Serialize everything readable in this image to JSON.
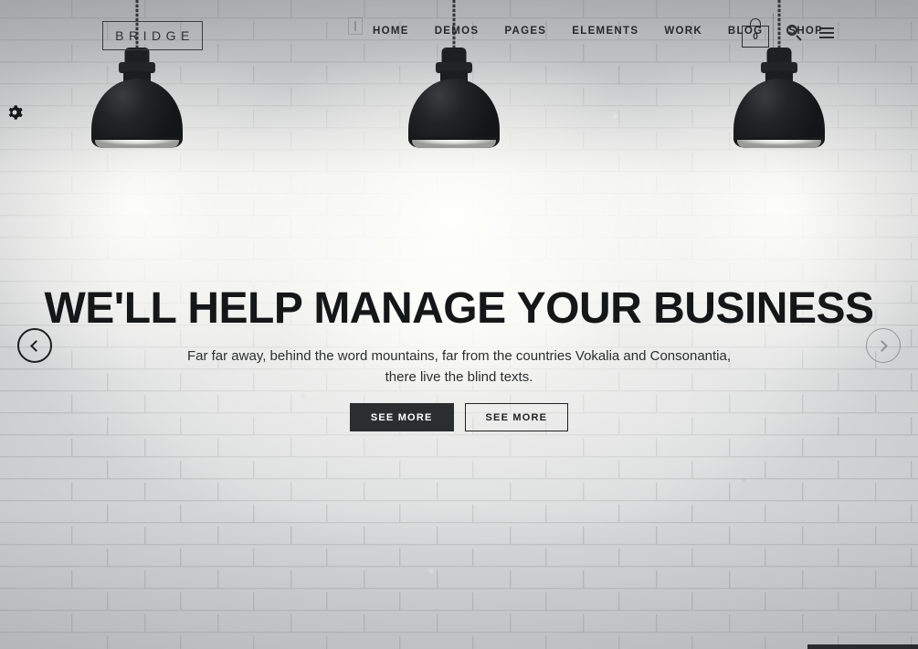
{
  "site": {
    "logo_text": "BRIDGE"
  },
  "header": {
    "nav_items": [
      {
        "label": "HOME"
      },
      {
        "label": "DEMOS"
      },
      {
        "label": "PAGES"
      },
      {
        "label": "ELEMENTS"
      },
      {
        "label": "WORK"
      },
      {
        "label": "BLOG"
      },
      {
        "label": "SHOP"
      }
    ],
    "cart_count": "0",
    "icons": {
      "cart": "shopping-bag-icon",
      "search": "search-icon",
      "menu": "hamburger-menu-icon"
    }
  },
  "side_widget": {
    "icon": "gear-icon"
  },
  "hero": {
    "title": "WE'LL HELP MANAGE YOUR BUSINESS",
    "subtitle_line1": "Far far away, behind the word mountains, far from the countries Vokalia and Consonantia,",
    "subtitle_line2": "there live the blind texts.",
    "primary_button": "SEE MORE",
    "secondary_button": "SEE MORE"
  },
  "slider": {
    "prev_icon": "chevron-left-icon",
    "next_icon": "chevron-right-icon"
  },
  "colors": {
    "text_dark": "#151617",
    "button_fill": "#2c2d2e",
    "button_text": "#ffffff",
    "wall_base": "#d8d9da",
    "lamp_black": "#1c1d1e"
  }
}
